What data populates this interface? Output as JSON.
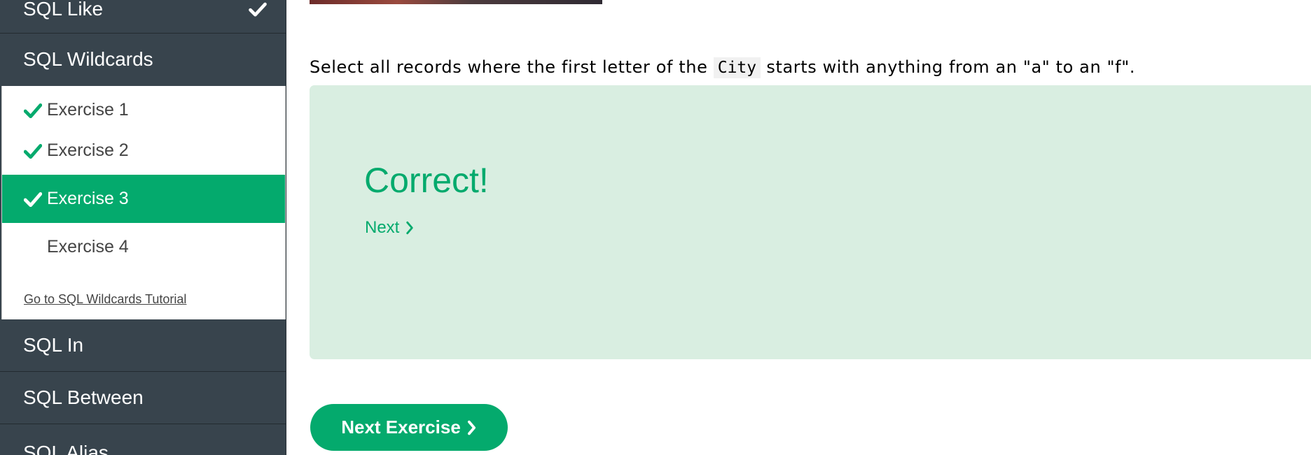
{
  "sidebar": {
    "sections_above": [
      {
        "label": "SQL Like",
        "completed": true
      },
      {
        "label": "SQL Wildcards"
      }
    ],
    "exercises": [
      {
        "label": "Exercise 1",
        "completed": true,
        "active": false
      },
      {
        "label": "Exercise 2",
        "completed": true,
        "active": false
      },
      {
        "label": "Exercise 3",
        "completed": true,
        "active": true
      },
      {
        "label": "Exercise 4",
        "completed": false,
        "active": false
      }
    ],
    "tutorial_link": "Go to SQL Wildcards Tutorial",
    "sections_below": [
      {
        "label": "SQL In"
      },
      {
        "label": "SQL Between"
      },
      {
        "label": "SQL Alias"
      }
    ]
  },
  "main": {
    "instruction": {
      "before": "Select all records where the first letter of the ",
      "code": "City",
      "after": " starts with anything from an \"a\" to an \"f\"."
    },
    "result": {
      "title": "Correct!",
      "next_link": "Next"
    },
    "next_exercise_button": "Next Exercise"
  },
  "colors": {
    "accent": "#04aa6d",
    "sidebar_bg": "#38444d",
    "result_bg": "#d9eee1"
  },
  "icons": {
    "completed": "check-icon",
    "next": "chevron-right-icon"
  }
}
